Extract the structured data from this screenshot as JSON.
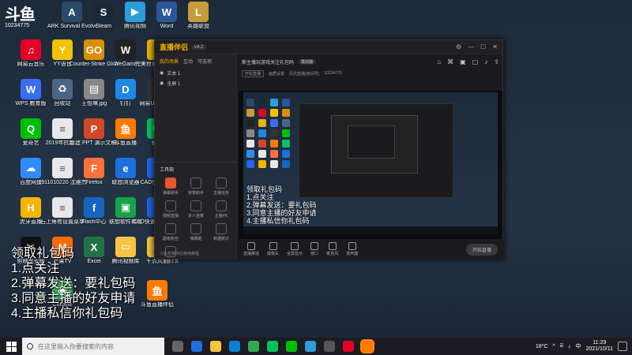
{
  "colors": {
    "accent": "#f5b300",
    "live_orange": "#e8572b",
    "taskbar": "#1c1c22",
    "window_bg": "#1b1b1f"
  },
  "logo": {
    "big": "斗鱼",
    "small": "10234775"
  },
  "desktop": {
    "icons": [
      {
        "label": "ARK Survival Evolved",
        "icon": "ark-icon",
        "color": "#2a4a6a",
        "glyph": "A"
      },
      {
        "label": "Steam",
        "icon": "steam-icon",
        "color": "#1b2838",
        "glyph": "S"
      },
      {
        "label": "腾讯视频",
        "icon": "tencent-video-icon",
        "color": "#2d9cdb",
        "glyph": "▶"
      },
      {
        "label": "Word",
        "icon": "word-icon",
        "color": "#2b579a",
        "glyph": "W"
      },
      {
        "label": "英雄联盟",
        "icon": "lol-icon",
        "color": "#c89b3c",
        "glyph": "L"
      },
      {
        "label": "网易云音乐",
        "icon": "netease-music-icon",
        "color": "#e60026",
        "glyph": "♫"
      },
      {
        "label": "YY语音",
        "icon": "yy-icon",
        "color": "#f2c200",
        "glyph": "Y"
      },
      {
        "label": "Counter-Strike Global Off...",
        "icon": "csgo-icon",
        "color": "#d98e04",
        "glyph": "GO"
      },
      {
        "label": "WeGame",
        "icon": "wegame-icon",
        "color": "#222",
        "glyph": "W"
      },
      {
        "label": "完美世界竞技平台",
        "icon": "perfect-world-icon",
        "color": "#eab308",
        "glyph": "P"
      },
      {
        "label": "WPS 教育版",
        "icon": "wps-icon",
        "color": "#3a6df0",
        "glyph": "W"
      },
      {
        "label": "回收站",
        "icon": "recycle-bin-icon",
        "color": "#4b6584",
        "glyph": "♻"
      },
      {
        "label": "王怡琳.jpg",
        "icon": "image-file-icon",
        "color": "#888",
        "glyph": "▤"
      },
      {
        "label": "钉钉",
        "icon": "dingtalk-icon",
        "color": "#1e88e5",
        "glyph": "D"
      },
      {
        "label": "网易UU加速器",
        "icon": "uu-icon",
        "color": "#333",
        "glyph": "U"
      },
      {
        "label": "爱奇艺",
        "icon": "iqiyi-icon",
        "color": "#00be06",
        "glyph": "Q"
      },
      {
        "label": "2019年抗疫...",
        "icon": "document-icon",
        "color": "#e8e8e8",
        "glyph": "≡"
      },
      {
        "label": "新建 PPT 演示文稿.pptx",
        "icon": "pptx-icon",
        "color": "#d24726",
        "glyph": "P"
      },
      {
        "label": "斗鱼直播",
        "icon": "douyu-icon",
        "color": "#ff7a00",
        "glyph": "鱼"
      },
      {
        "label": "微信",
        "icon": "wechat-icon",
        "color": "#07c160",
        "glyph": "✉"
      },
      {
        "label": "百度网盘",
        "icon": "baidu-pan-icon",
        "color": "#2f8cff",
        "glyph": "☁"
      },
      {
        "label": "1911010220 沈雅杰",
        "icon": "document-icon",
        "color": "#e8e8e8",
        "glyph": "≡"
      },
      {
        "label": "Firefox",
        "icon": "firefox-icon",
        "color": "#ff7139",
        "glyph": "F"
      },
      {
        "label": "联想浏览器",
        "icon": "lenovo-browser-icon",
        "color": "#1e6fe0",
        "glyph": "e"
      },
      {
        "label": "CAD快速看图",
        "icon": "cad-icon",
        "color": "#2563eb",
        "glyph": "C"
      },
      {
        "label": "虎牙直播",
        "icon": "huya-icon",
        "color": "#f7b500",
        "glyph": "H"
      },
      {
        "label": "石上角有设置菜单",
        "icon": "document-icon",
        "color": "#e8e8e8",
        "glyph": "≡"
      },
      {
        "label": "Flash中心",
        "icon": "flash-icon",
        "color": "#1565c0",
        "glyph": "f"
      },
      {
        "label": "联想软件商店",
        "icon": "lenovo-store-icon",
        "color": "#16a34a",
        "glyph": "▣"
      },
      {
        "label": "CAD快速看图-编辑助手",
        "icon": "cad-icon",
        "color": "#2563eb",
        "glyph": "C"
      },
      {
        "label": "剪映专业版",
        "icon": "jianying-icon",
        "color": "#111",
        "glyph": "✂"
      },
      {
        "label": "芒果TV",
        "icon": "mango-icon",
        "color": "#ff6a00",
        "glyph": "M"
      },
      {
        "label": "Excel",
        "icon": "excel-icon",
        "color": "#217346",
        "glyph": "X"
      },
      {
        "label": "腾讯视频库",
        "icon": "folder-icon",
        "color": "#f4c542",
        "glyph": "▭"
      },
      {
        "label": "千点风讯",
        "icon": "folder-icon",
        "color": "#f4c542",
        "glyph": "▭"
      },
      {
        "label": "Chrome",
        "icon": "chrome-icon",
        "color": "#34a853",
        "glyph": "◉"
      },
      {
        "label": "斗鱼直播伴侣",
        "icon": "douyu-companion-icon",
        "color": "#ff7a00",
        "glyph": "鱼"
      }
    ]
  },
  "app": {
    "brand": "直播伴侣",
    "version": "v4.2",
    "tabs": [
      "我的场景",
      "互动",
      "可选项"
    ],
    "scenes": [
      "文本 1",
      "全屏 1"
    ],
    "toolbox_title": "工具箱",
    "tools": [
      "弹幕助手",
      "房管助手",
      "主播任务",
      "视频直播",
      "多人连麦",
      "主播PK",
      "超级粉丝",
      "弹幕姬",
      "数据统计",
      "主播工具",
      "",
      ""
    ],
    "footer": "斗鱼直播伴侣使用教程",
    "room_title": "斯主播玩游戏关注礼包码",
    "room_badge": "模拟器",
    "room_sub": [
      "开始直播",
      "画质设置",
      "风讯直播(房间号)",
      "10234775"
    ],
    "controls": [
      "直播推流",
      "摄像头",
      "全屏显示",
      "窗口",
      "麦克风",
      "扬声器"
    ],
    "start_live": "开始直播"
  },
  "overlay": {
    "lines": [
      "领取礼包码",
      "1.点关注",
      "2.弹幕发送：要礼包码",
      "3.同意主播的好友申请",
      "4.主播私信你礼包码"
    ]
  },
  "taskbar": {
    "search_placeholder": "在这里输入你要搜索的内容",
    "apps": [
      {
        "icon": "task-view-icon",
        "color": "#666"
      },
      {
        "icon": "lenovo-icon",
        "color": "#1e6fe0"
      },
      {
        "icon": "file-explorer-icon",
        "color": "#f4c542"
      },
      {
        "icon": "edge-icon",
        "color": "#0c7ed6"
      },
      {
        "icon": "chrome-icon",
        "color": "#34a853"
      },
      {
        "icon": "wechat-icon",
        "color": "#07c160"
      },
      {
        "icon": "iqiyi-icon",
        "color": "#00be06"
      },
      {
        "icon": "tencent-video-icon",
        "color": "#2d9cdb"
      },
      {
        "icon": "unknown-app-icon",
        "color": "#555"
      },
      {
        "icon": "netease-music-icon",
        "color": "#e60026"
      },
      {
        "icon": "douyu-companion-icon",
        "color": "#ff7a00"
      }
    ],
    "weather": "18°C",
    "ime": "中",
    "time": "11:29",
    "date": "2021/10/11"
  }
}
